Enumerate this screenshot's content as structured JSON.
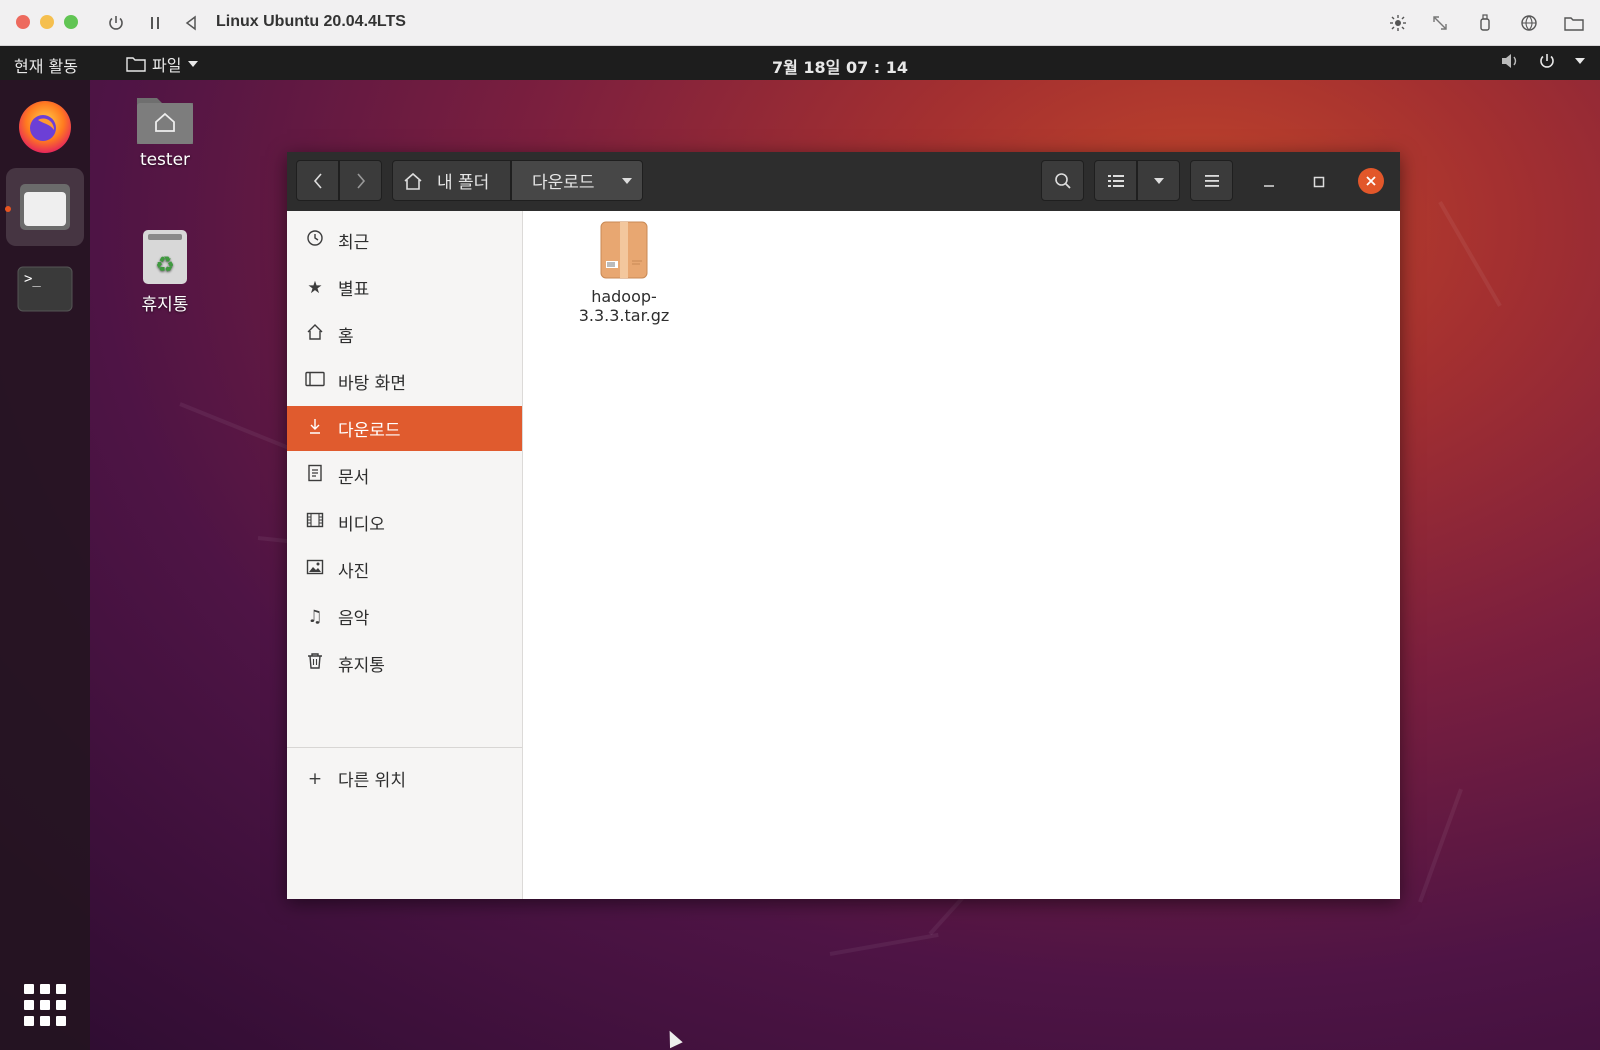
{
  "mac_window": {
    "title": "Linux Ubuntu 20.04.4LTS",
    "controls": [
      "power-icon",
      "pause-icon",
      "back-icon"
    ],
    "right_tools": [
      "brightness-icon",
      "resize-icon",
      "usb-icon",
      "network-icon",
      "shared-folder-icon"
    ]
  },
  "top_panel": {
    "activities": "현재 활동",
    "app_menu": "파일",
    "clock": "7월 18일  07 : 14"
  },
  "desktop_icons": [
    {
      "label": "tester",
      "icon": "home-folder-icon"
    },
    {
      "label": "휴지통",
      "icon": "trash-icon"
    }
  ],
  "dock": [
    {
      "name": "firefox",
      "icon": "firefox-icon"
    },
    {
      "name": "files",
      "icon": "files-icon",
      "active": true
    },
    {
      "name": "terminal",
      "icon": "terminal-icon"
    }
  ],
  "file_manager": {
    "path": {
      "home": "내 폴더",
      "current": "다운로드"
    },
    "sidebar": [
      {
        "label": "최근",
        "icon": "recent-icon"
      },
      {
        "label": "별표",
        "icon": "star-icon"
      },
      {
        "label": "홈",
        "icon": "home-icon"
      },
      {
        "label": "바탕 화면",
        "icon": "desktop-icon"
      },
      {
        "label": "다운로드",
        "icon": "download-icon",
        "selected": true
      },
      {
        "label": "문서",
        "icon": "document-icon"
      },
      {
        "label": "비디오",
        "icon": "video-icon"
      },
      {
        "label": "사진",
        "icon": "picture-icon"
      },
      {
        "label": "음악",
        "icon": "music-icon"
      },
      {
        "label": "휴지통",
        "icon": "trash-icon"
      }
    ],
    "other_locations": "다른 위치",
    "files": [
      {
        "name_line1": "hadoop-",
        "name_line2": "3.3.3.tar.gz",
        "icon": "archive-icon"
      }
    ]
  },
  "colors": {
    "accent": "#e05b2e",
    "close": "#e2572a"
  }
}
